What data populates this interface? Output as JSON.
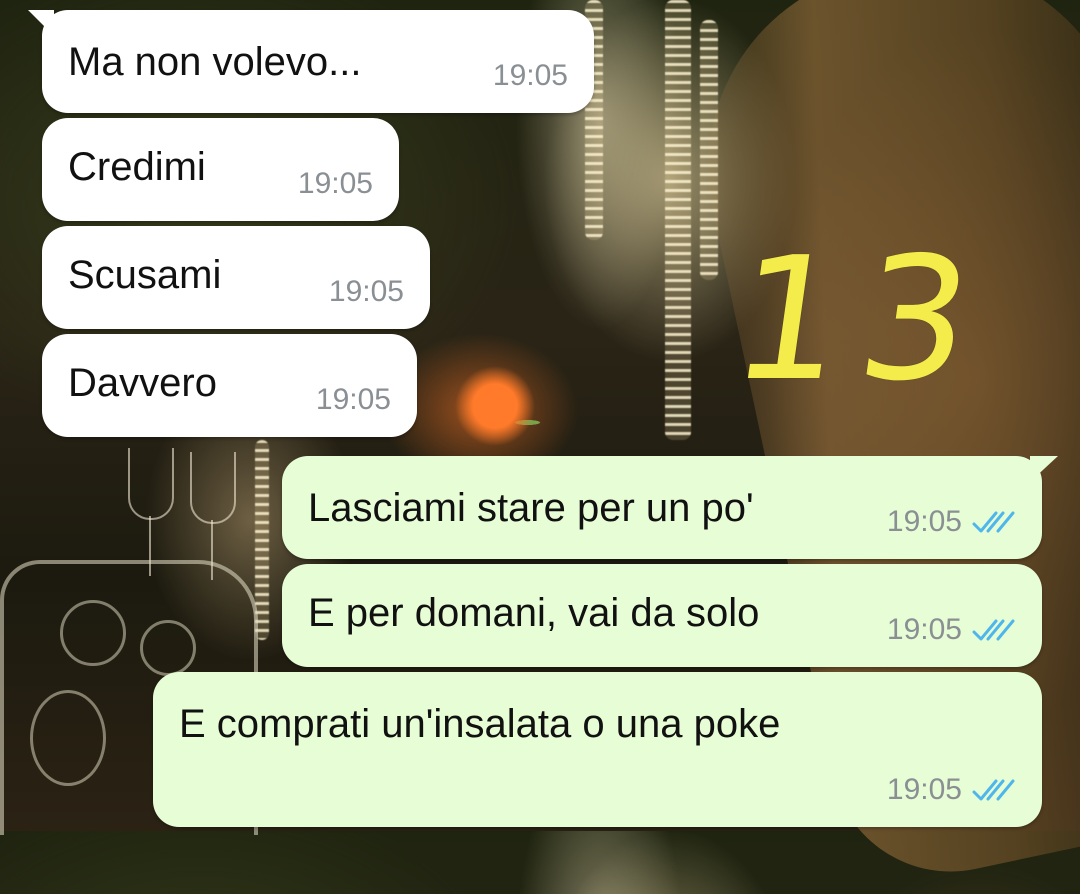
{
  "annotation": {
    "text": "13",
    "color": "#f4ec4a"
  },
  "colors": {
    "incoming_bubble": "#ffffff",
    "outgoing_bubble": "#e7fdd5",
    "timestamp": "#8a8f94",
    "read_ticks": "#4fb6ec"
  },
  "messages": [
    {
      "direction": "incoming",
      "text": "Ma non volevo...",
      "time": "19:05"
    },
    {
      "direction": "incoming",
      "text": "Credimi",
      "time": "19:05"
    },
    {
      "direction": "incoming",
      "text": "Scusami",
      "time": "19:05"
    },
    {
      "direction": "incoming",
      "text": "Davvero",
      "time": "19:05"
    },
    {
      "direction": "outgoing",
      "text": "Lasciami stare per un po'",
      "time": "19:05",
      "status": "read",
      "status_icon": "double-check-icon"
    },
    {
      "direction": "outgoing",
      "text": "E per domani, vai da solo",
      "time": "19:05",
      "status": "read",
      "status_icon": "double-check-icon"
    },
    {
      "direction": "outgoing",
      "text": "E comprati un'insalata o una poke",
      "time": "19:05",
      "status": "read",
      "status_icon": "double-check-icon"
    }
  ]
}
